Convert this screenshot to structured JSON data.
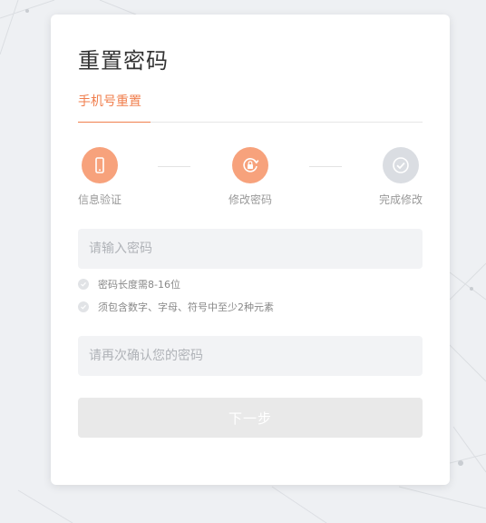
{
  "page": {
    "title": "重置密码"
  },
  "tabs": [
    {
      "label": "手机号重置",
      "active": true
    }
  ],
  "steps": [
    {
      "label": "信息验证",
      "icon": "phone-icon",
      "state": "done"
    },
    {
      "label": "修改密码",
      "icon": "lock-refresh-icon",
      "state": "active"
    },
    {
      "label": "完成修改",
      "icon": "check-circle-icon",
      "state": "pending"
    }
  ],
  "form": {
    "password": {
      "value": "",
      "placeholder": "请输入密码"
    },
    "hints": [
      "密码长度需8-16位",
      "须包含数字、字母、符号中至少2种元素"
    ],
    "confirm_password": {
      "value": "",
      "placeholder": "请再次确认您的密码"
    },
    "next_label": "下一步"
  },
  "colors": {
    "accent": "#f07f4e",
    "step_active": "#f7a27c",
    "step_inactive": "#dadde2",
    "input_bg": "#f2f3f5",
    "button_disabled": "#e9e9e9"
  }
}
